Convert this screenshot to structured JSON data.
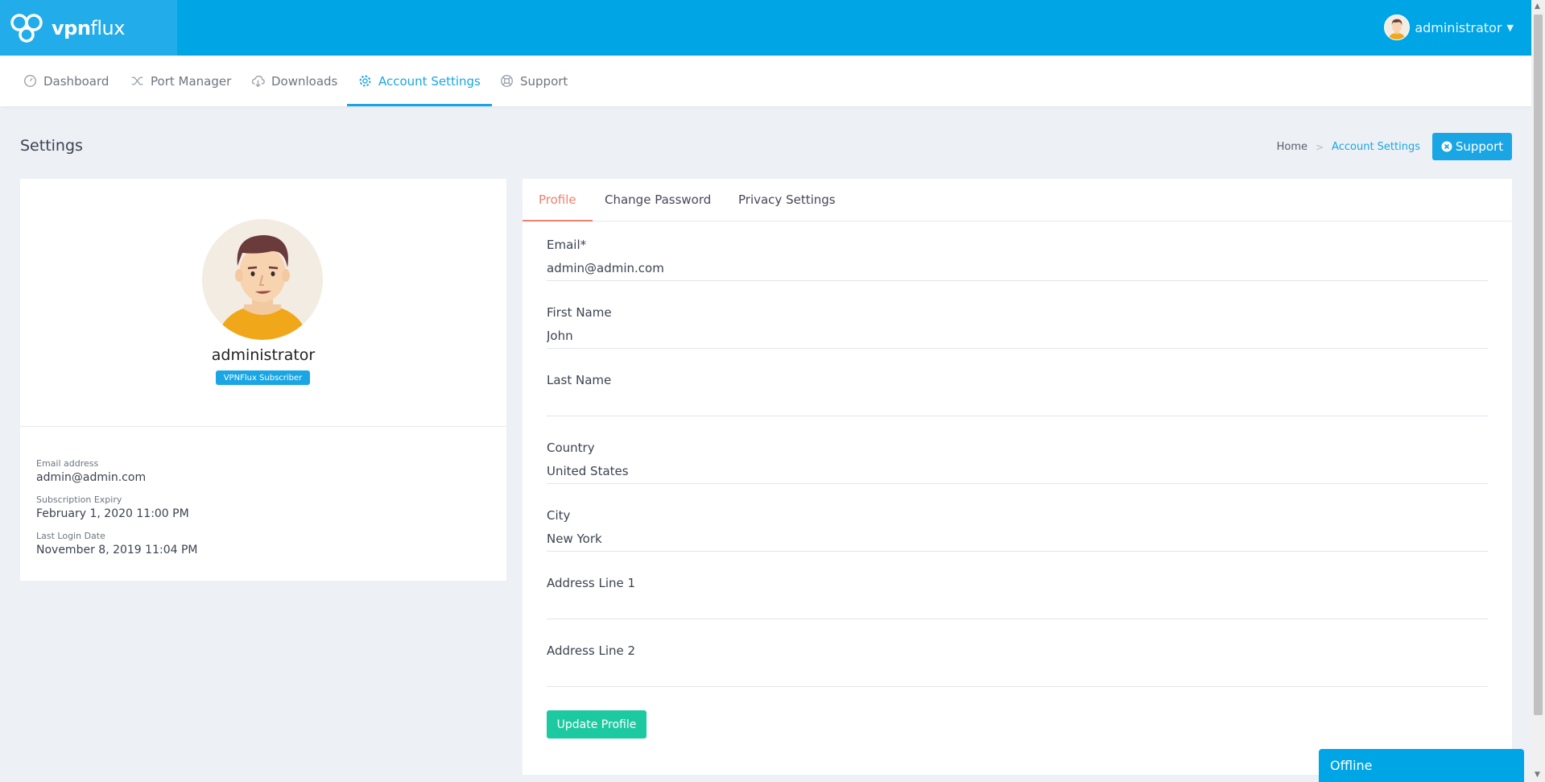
{
  "brand": {
    "name_bold": "vpn",
    "name_light": "flux",
    "color": "#00a5e6"
  },
  "header": {
    "username": "administrator"
  },
  "nav": [
    {
      "label": "Dashboard",
      "icon": "gauge-icon"
    },
    {
      "label": "Port Manager",
      "icon": "shuffle-icon"
    },
    {
      "label": "Downloads",
      "icon": "cloud-download-icon"
    },
    {
      "label": "Account Settings",
      "icon": "gear-icon",
      "active": true
    },
    {
      "label": "Support",
      "icon": "lifebuoy-icon"
    }
  ],
  "subheader": {
    "title": "Settings",
    "breadcrumb_home": "Home",
    "breadcrumb_current": "Account Settings",
    "support_label": "Support"
  },
  "profile_card": {
    "name": "administrator",
    "badge": "VPNFlux Subscriber",
    "email_label": "Email address",
    "email_value": "admin@admin.com",
    "expiry_label": "Subscription Expiry",
    "expiry_value": "February 1, 2020 11:00 PM",
    "login_label": "Last Login Date",
    "login_value": "November 8, 2019 11:04 PM"
  },
  "tabs": [
    {
      "label": "Profile",
      "active": true
    },
    {
      "label": "Change Password"
    },
    {
      "label": "Privacy Settings"
    }
  ],
  "form": {
    "email": {
      "label": "Email*",
      "value": "admin@admin.com"
    },
    "first_name": {
      "label": "First Name",
      "value": "John"
    },
    "last_name": {
      "label": "Last Name",
      "value": ""
    },
    "country": {
      "label": "Country",
      "value": "United States"
    },
    "city": {
      "label": "City",
      "value": "New York"
    },
    "address1": {
      "label": "Address Line 1",
      "value": ""
    },
    "address2": {
      "label": "Address Line 2",
      "value": ""
    },
    "submit_label": "Update Profile"
  },
  "chat_widget": {
    "status": "Offline"
  },
  "colors": {
    "accent": "#1aa6e4",
    "tab_active": "#f0816c",
    "success": "#1dc9a0",
    "background": "#edf0f5"
  }
}
